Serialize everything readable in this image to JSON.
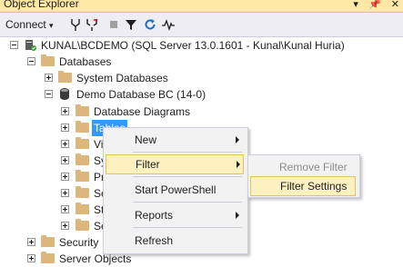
{
  "window": {
    "title": "Object Explorer",
    "title_icons": [
      "▾",
      "📌",
      "✕"
    ]
  },
  "toolbar": {
    "connect_label": "Connect",
    "items": [
      "connect-icon",
      "disconnect-icon",
      "stop-icon",
      "filter-icon",
      "refresh-icon",
      "activity-monitor-icon"
    ]
  },
  "tree": {
    "server": "KUNAL\\BCDEMO (SQL Server 13.0.1601 - Kunal\\Kunal Huria)",
    "databases": "Databases",
    "system_databases": "System Databases",
    "demo_db": "Demo Database BC (14-0)",
    "database_diagrams": "Database Diagrams",
    "tables": "Tables",
    "views_partial": "Vi",
    "synonyms_partial": "Sy",
    "programmability_partial": "Pr",
    "service_broker_partial": "Se",
    "storage_partial": "St",
    "security_db_partial": "Se",
    "security": "Security",
    "server_objects": "Server Objects"
  },
  "context_menu": {
    "new": "New",
    "filter": "Filter",
    "start_powershell": "Start PowerShell",
    "reports": "Reports",
    "refresh": "Refresh"
  },
  "filter_submenu": {
    "remove_filter": "Remove Filter",
    "filter_settings": "Filter Settings"
  },
  "colors": {
    "title_bg": "#ffe8a6",
    "selection": "#3399ff",
    "menu_highlight": "#fef1c0",
    "folder": "#dcb67a"
  }
}
